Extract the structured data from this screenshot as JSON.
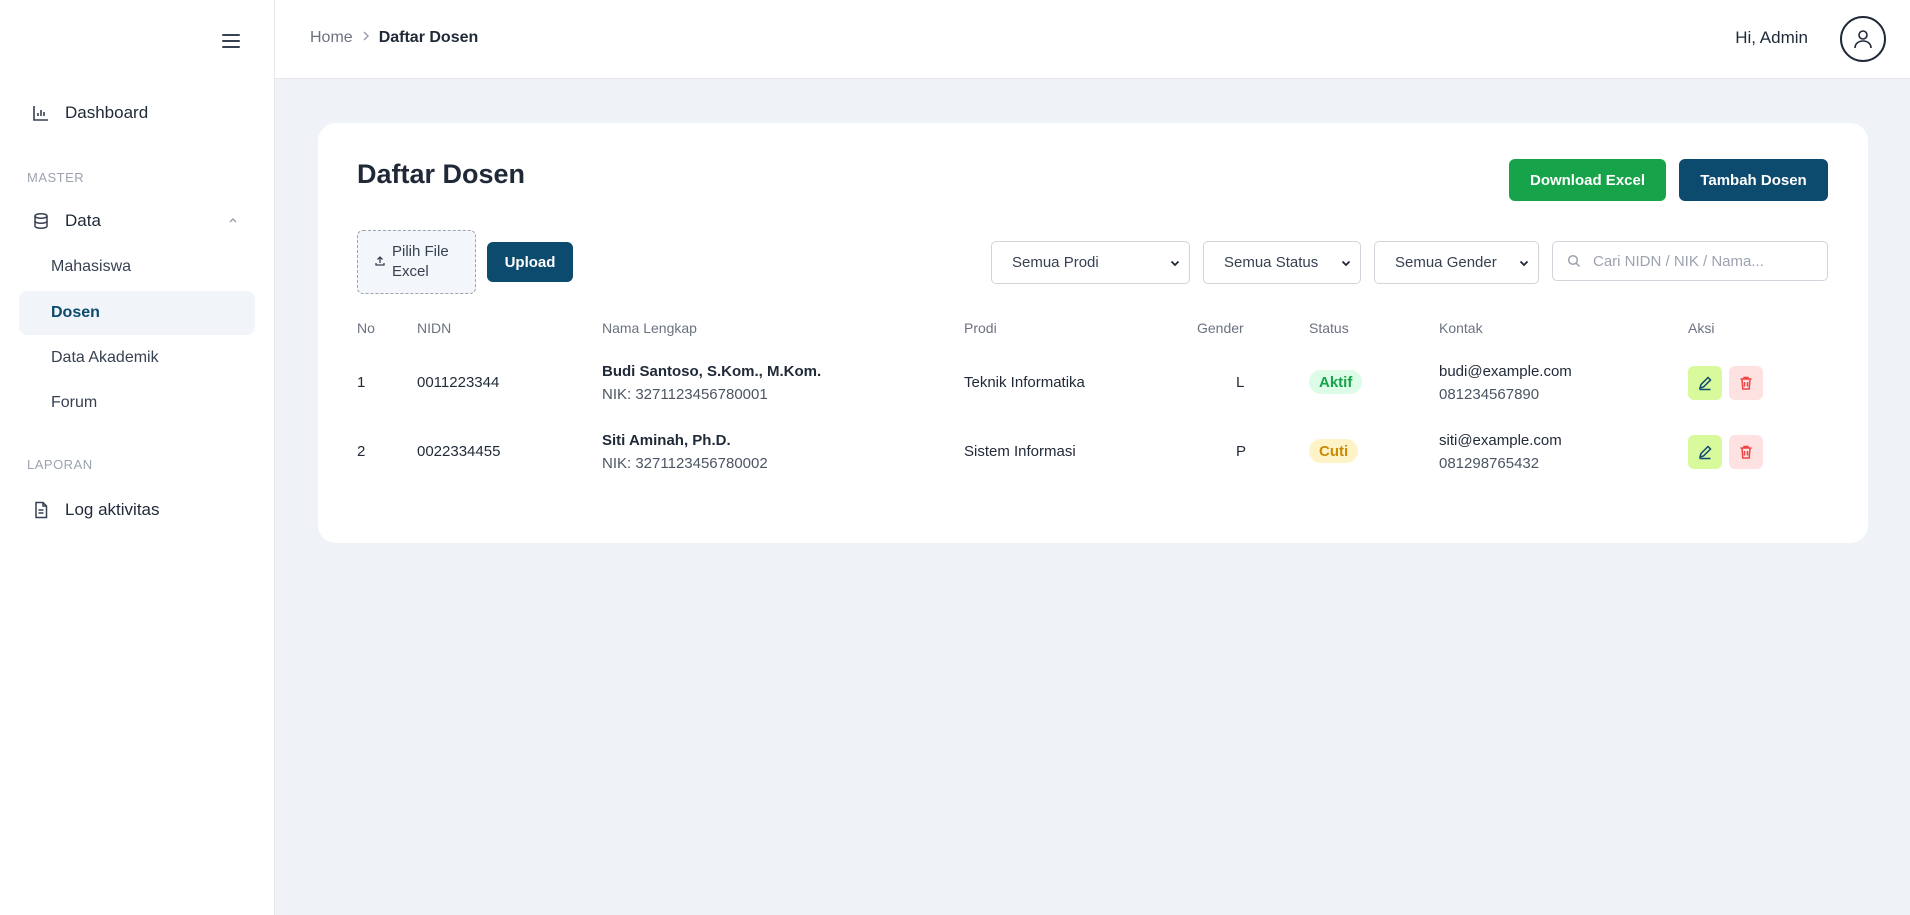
{
  "sidebar": {
    "dashboard": "Dashboard",
    "section_master": "MASTER",
    "data_group": "Data",
    "sub_items": [
      "Mahasiswa",
      "Dosen",
      "Data Akademik",
      "Forum"
    ],
    "section_laporan": "LAPORAN",
    "log": "Log aktivitas"
  },
  "header": {
    "breadcrumb_home": "Home",
    "breadcrumb_current": "Daftar Dosen",
    "greeting": "Hi, Admin"
  },
  "main": {
    "title": "Daftar Dosen",
    "download_label": "Download Excel",
    "add_label": "Tambah Dosen",
    "file_pick_line1": "Pilih File",
    "file_pick_line2": "Excel",
    "upload_label": "Upload",
    "filter_prodi": "Semua Prodi",
    "filter_status": "Semua Status",
    "filter_gender": "Semua Gender",
    "search_placeholder": "Cari NIDN / NIK / Nama..."
  },
  "table": {
    "headers": [
      "No",
      "NIDN",
      "Nama Lengkap",
      "Prodi",
      "Gender",
      "Status",
      "Kontak",
      "Aksi"
    ],
    "rows": [
      {
        "no": "1",
        "nidn": "0011223344",
        "name": "Budi Santoso, S.Kom., M.Kom.",
        "nik": "NIK: 3271123456780001",
        "prodi": "Teknik Informatika",
        "gender": "L",
        "status": "Aktif",
        "email": "budi@example.com",
        "phone": "081234567890"
      },
      {
        "no": "2",
        "nidn": "0022334455",
        "name": "Siti Aminah, Ph.D.",
        "nik": "NIK: 3271123456780002",
        "prodi": "Sistem Informasi",
        "gender": "P",
        "status": "Cuti",
        "email": "siti@example.com",
        "phone": "081298765432"
      }
    ]
  },
  "colors": {
    "primary": "#0c4a6e",
    "success": "#16a34a",
    "background": "#eff3f7"
  }
}
